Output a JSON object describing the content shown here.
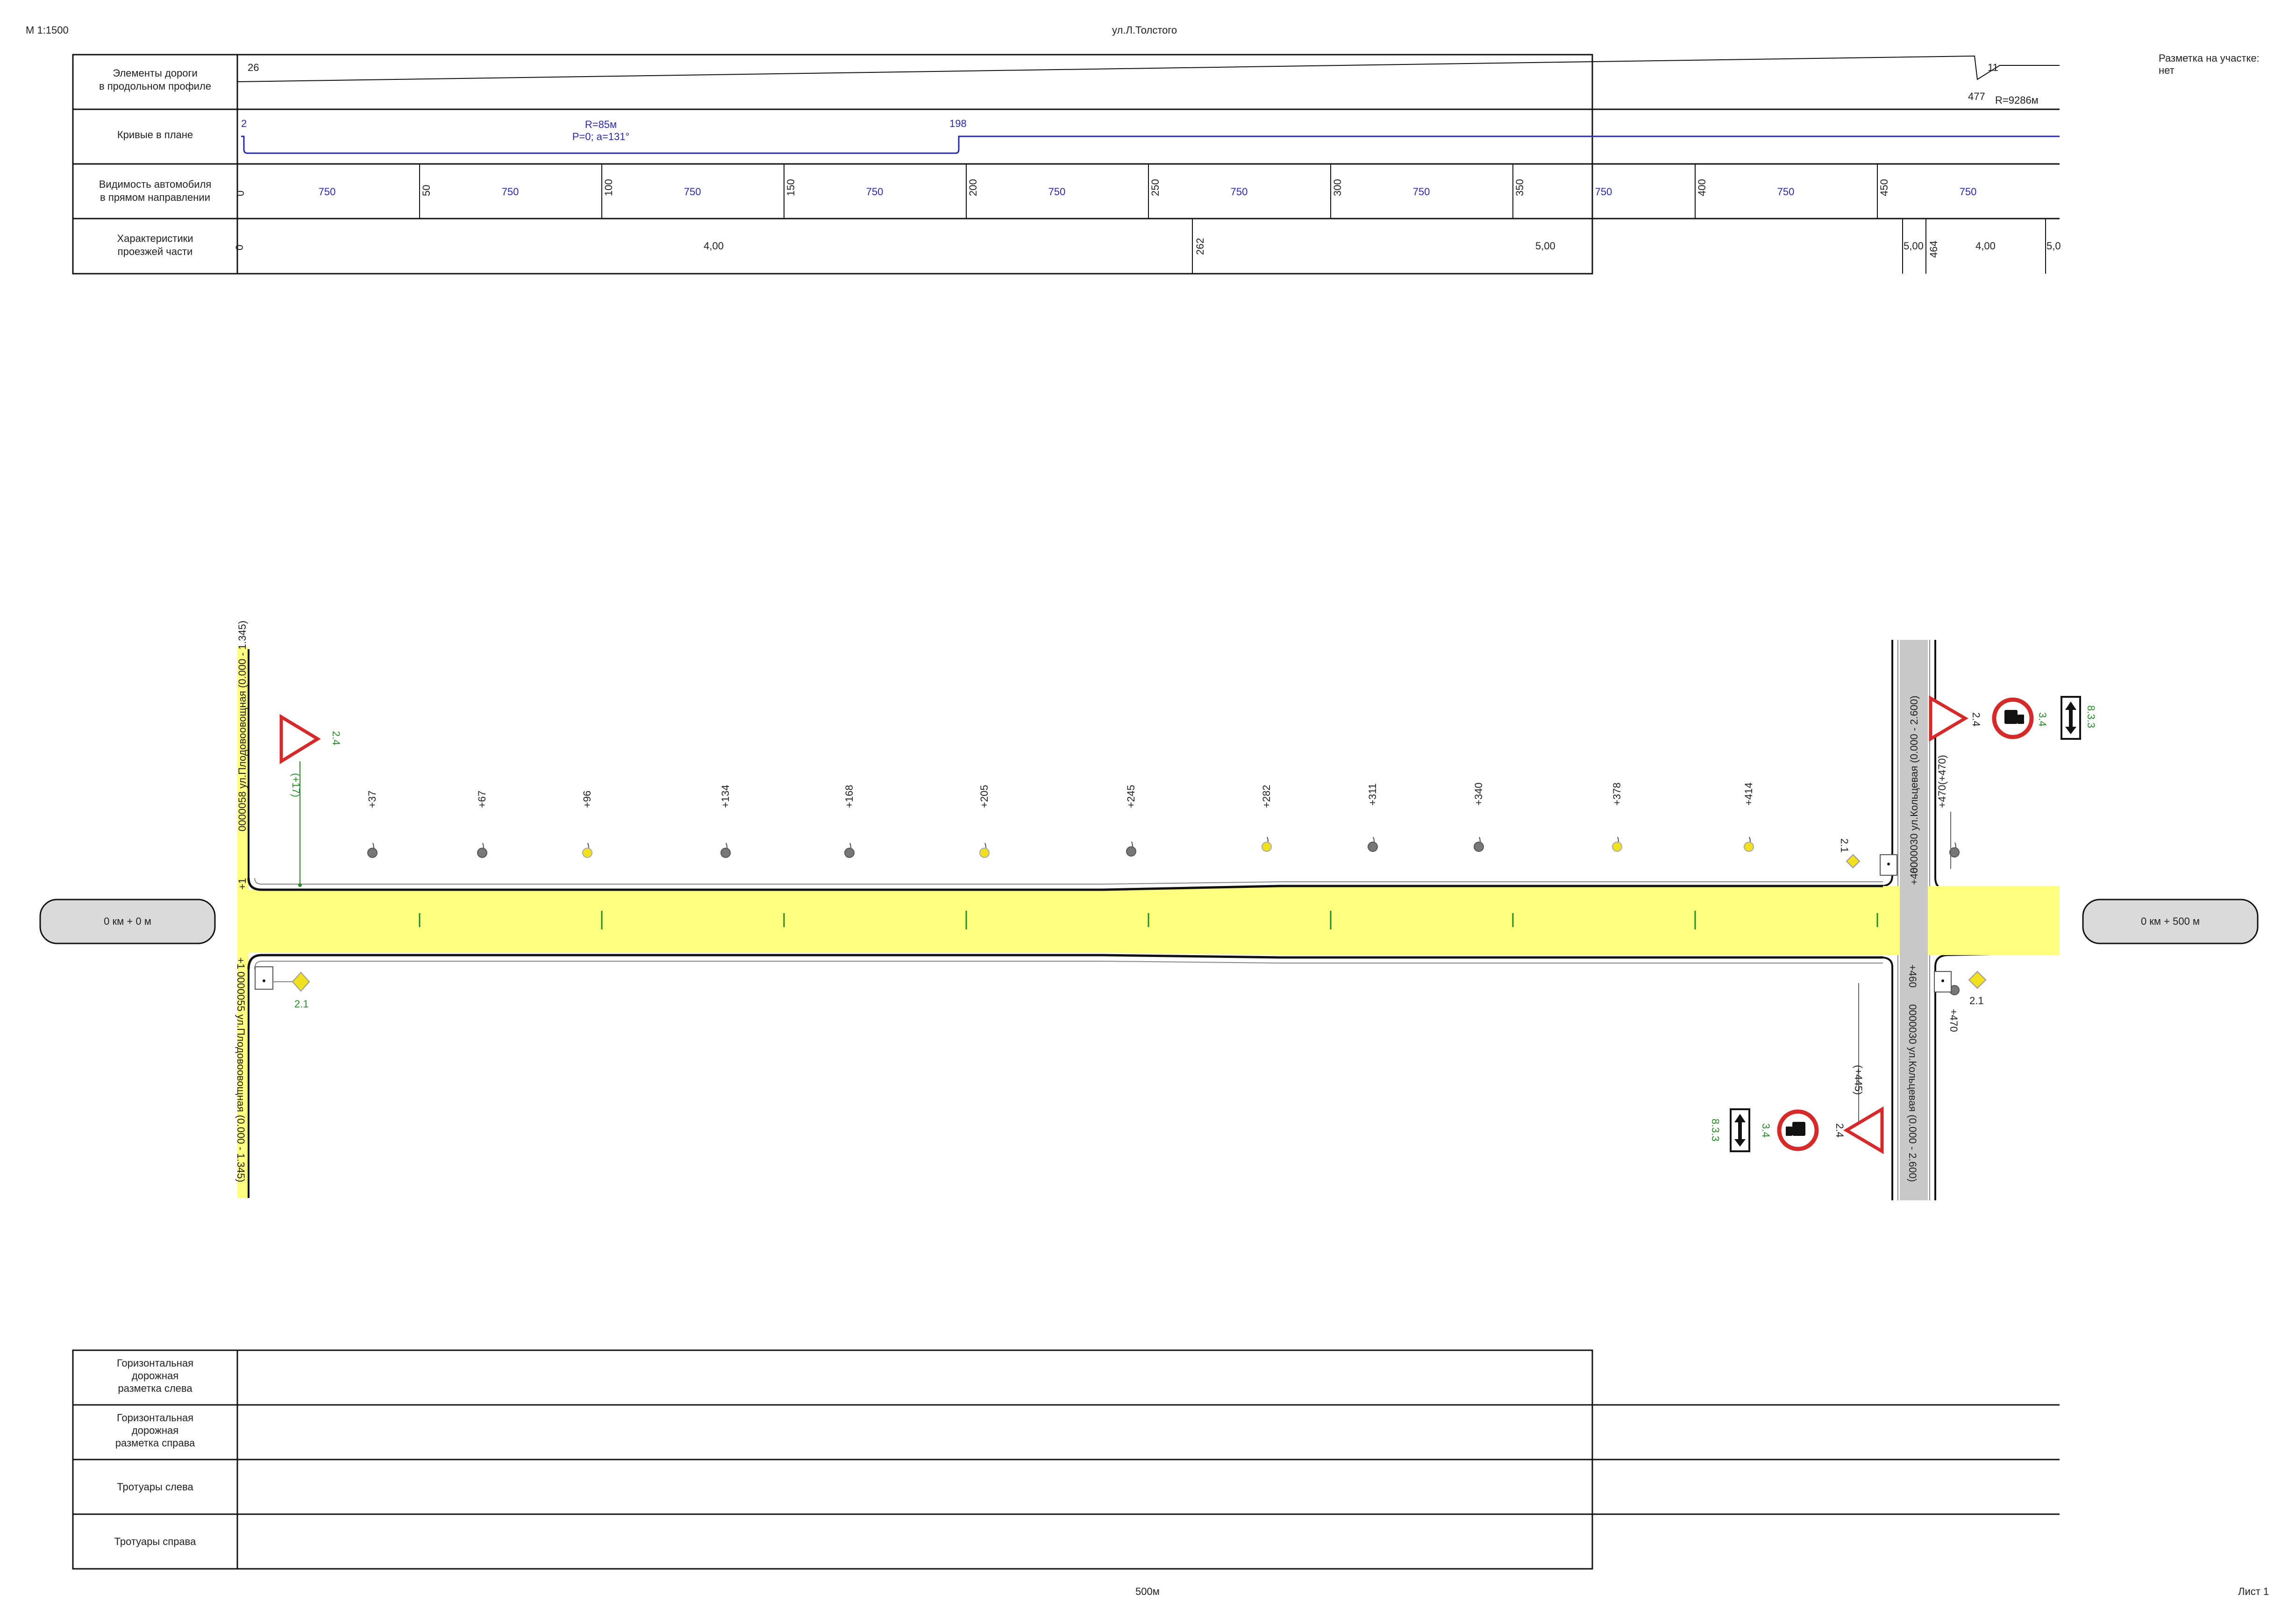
{
  "header": {
    "scale": "М 1:1500",
    "street": "ул.Л.Толстого",
    "marking_note_title": "Разметка на участке:",
    "marking_note_value": "нет"
  },
  "top_table": {
    "rows": [
      {
        "label_lines": [
          "Элементы дороги",
          "в продольном профиле"
        ]
      },
      {
        "label_lines": [
          "Кривые в плане"
        ]
      },
      {
        "label_lines": [
          "Видимость автомобиля",
          "в прямом направлении"
        ]
      },
      {
        "label_lines": [
          "Характеристики",
          "проезжей части"
        ]
      }
    ],
    "profile": {
      "start": "26",
      "end_value": "11",
      "end_station": "477",
      "radius": "R=9286м"
    },
    "curve": {
      "start": "2",
      "end": "198",
      "radius": "R=85м",
      "params": "P=0; a=131°"
    },
    "visibility": {
      "stations": [
        "0",
        "50",
        "100",
        "150",
        "200",
        "250",
        "300",
        "350",
        "400",
        "450"
      ],
      "values": [
        "750",
        "750",
        "750",
        "750",
        "750",
        "750",
        "750",
        "750",
        "750",
        "750"
      ]
    },
    "carriageway": {
      "stations": [
        "0",
        "262",
        "464"
      ],
      "widths": [
        "4,00",
        "5,00",
        "5,00",
        "4,00",
        "5,0"
      ]
    }
  },
  "plan": {
    "start_label": "0 км + 0 м",
    "end_label": "0 км + 500 м",
    "left_street_top": "0000058 ул.Плодовоовощная (0.000 - 1.345)",
    "left_street_bottom": "0000055 ул.Плодовоовощная (0.000 - 1.345)",
    "right_street_top": "0000030 ул.Кольцевая (0.000 - 2.600)",
    "right_street_bottom": "0000030 ул.Кольцевая (0.000 - 2.600)",
    "junction_left_top": "+1",
    "junction_left_bottom": "+1",
    "junction_right_top": "+460",
    "junction_right_bottom": "+460",
    "lights": [
      {
        "station": "+37",
        "color": "gray"
      },
      {
        "station": "+67",
        "color": "gray"
      },
      {
        "station": "+96",
        "color": "yellow"
      },
      {
        "station": "+134",
        "color": "gray"
      },
      {
        "station": "+168",
        "color": "gray"
      },
      {
        "station": "+205",
        "color": "yellow"
      },
      {
        "station": "+245",
        "color": "gray"
      },
      {
        "station": "+282",
        "color": "yellow"
      },
      {
        "station": "+311",
        "color": "gray"
      },
      {
        "station": "+340",
        "color": "gray"
      },
      {
        "station": "+378",
        "color": "yellow"
      },
      {
        "station": "+414",
        "color": "yellow"
      }
    ],
    "signs": {
      "yield": "2.4",
      "main_road": "2.1",
      "no_trucks": "3.4",
      "plate": "8.3.3",
      "left_yield_station": "(+17)",
      "right_top_station": "+470(+470)",
      "right_bottom_station": "+470",
      "bottom_sign_station": "(+445)"
    },
    "colors": {
      "road": "#ffff80",
      "line_green": "#2a8a2a",
      "curve_blue": "#2a2aa8",
      "sign_red": "#d42a2a"
    }
  },
  "bottom_table": {
    "rows": [
      {
        "label_lines": [
          "Горизонтальная",
          "дорожная",
          "разметка слева"
        ]
      },
      {
        "label_lines": [
          "Горизонтальная",
          "дорожная",
          "разметка справа"
        ]
      },
      {
        "label_lines": [
          "Тротуары слева"
        ]
      },
      {
        "label_lines": [
          "Тротуары справа"
        ]
      }
    ]
  },
  "footer": {
    "length": "500м",
    "sheet": "Лист 1"
  }
}
